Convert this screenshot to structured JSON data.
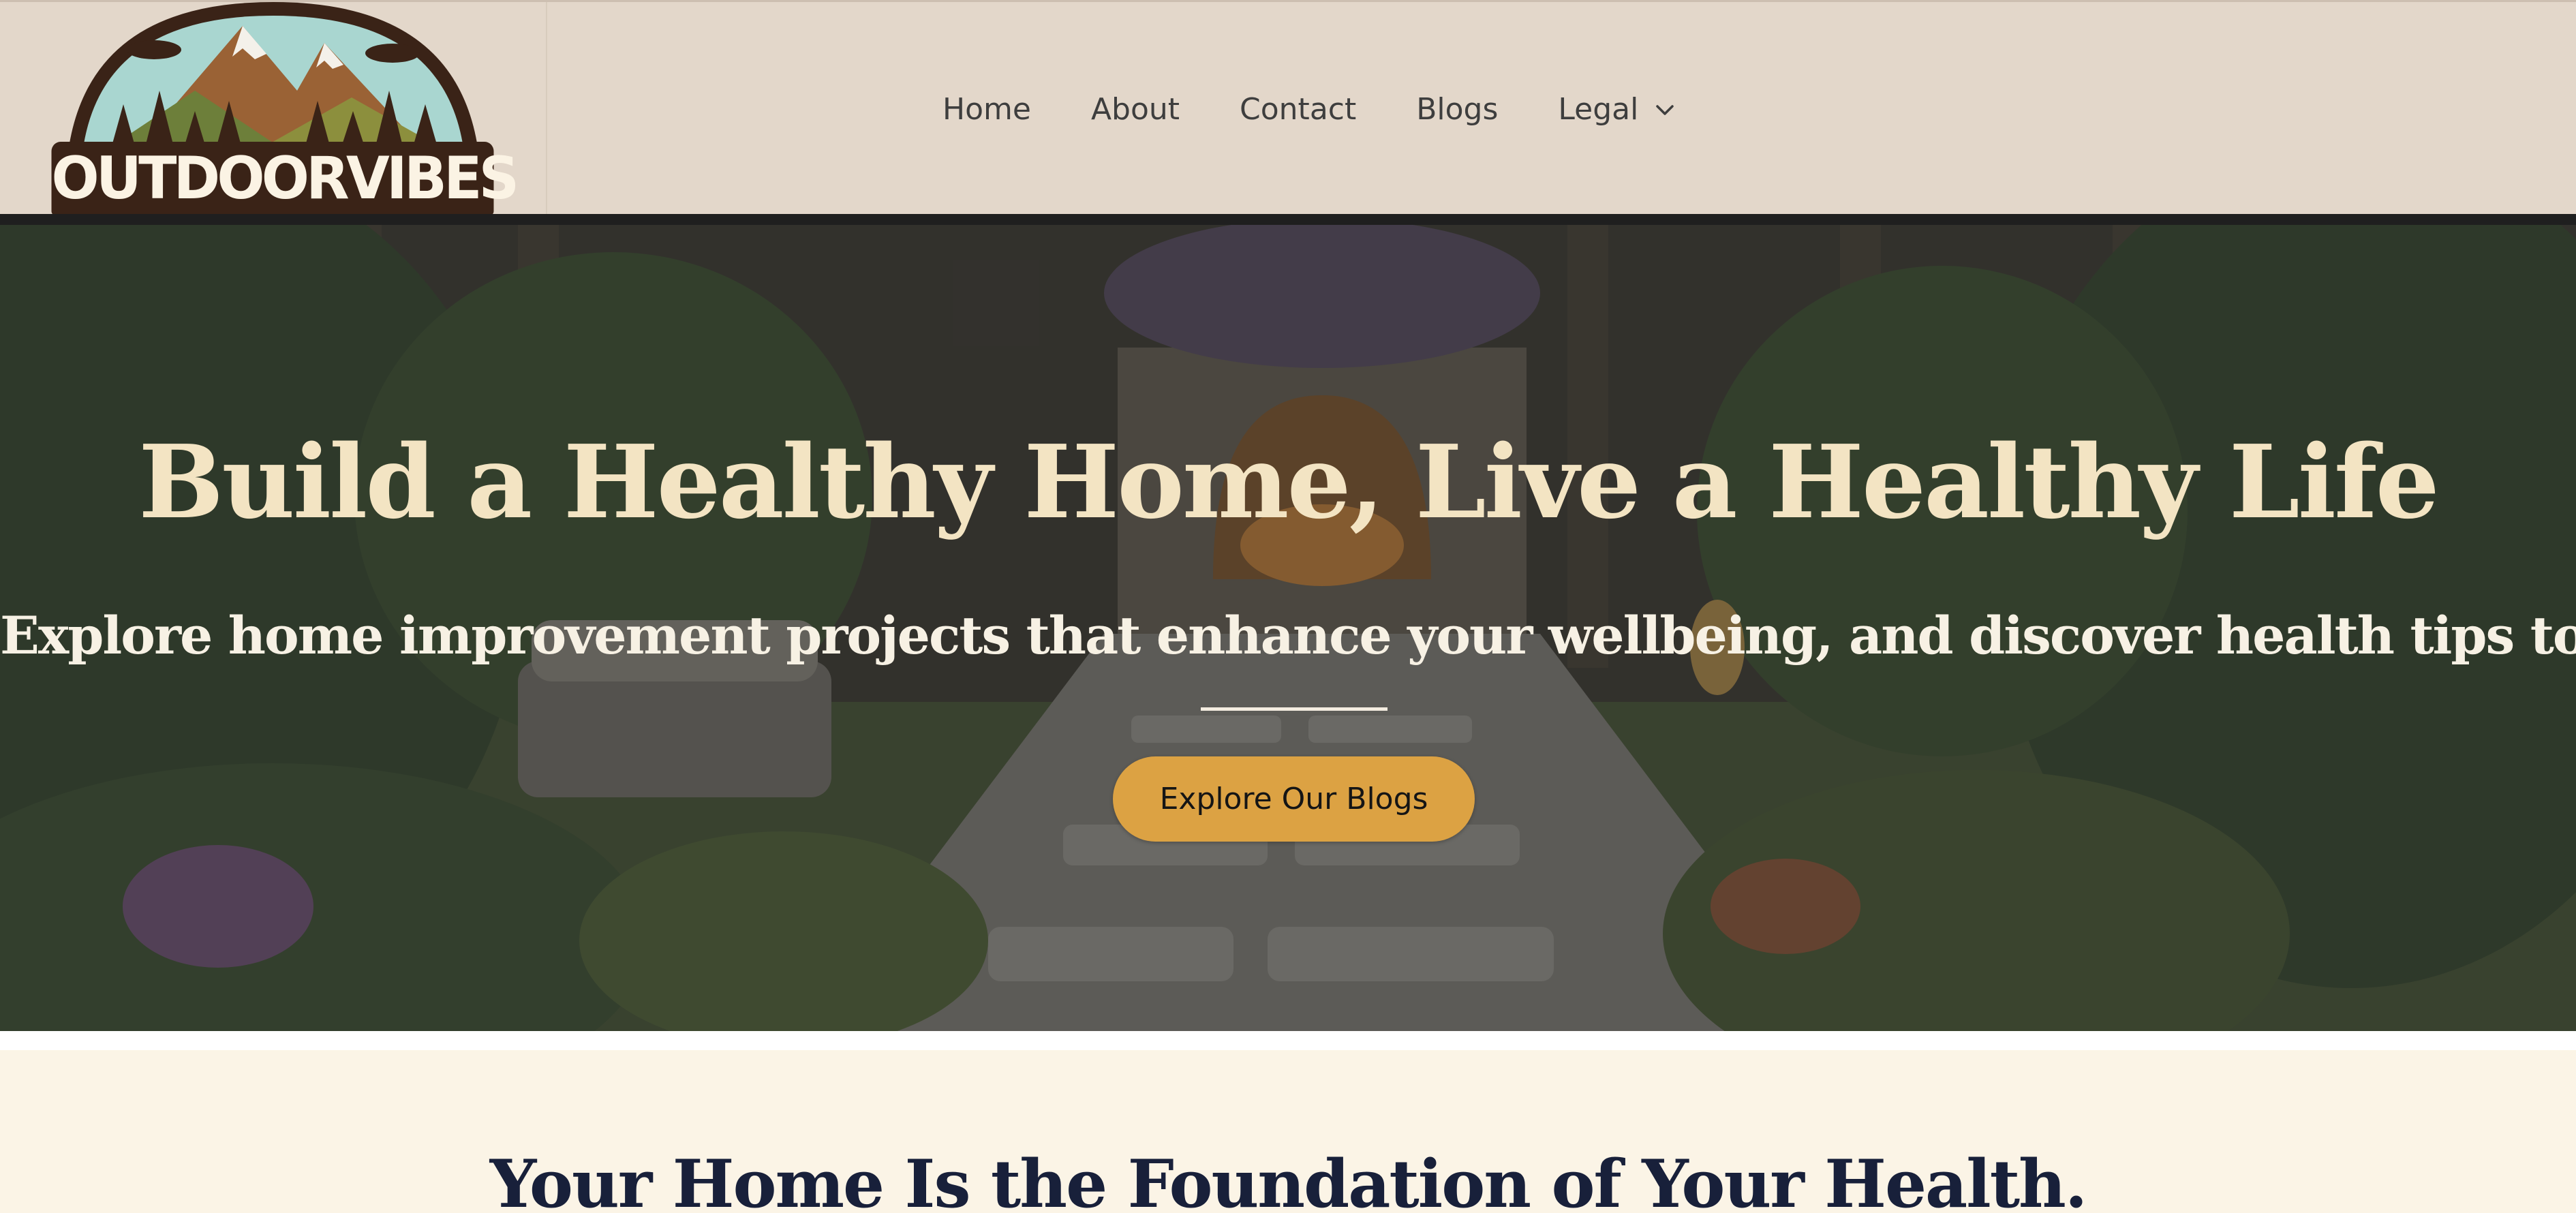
{
  "header": {
    "logo_text": "OUTDOORVIBES HUB",
    "nav": [
      {
        "label": "Home"
      },
      {
        "label": "About"
      },
      {
        "label": "Contact"
      },
      {
        "label": "Blogs"
      },
      {
        "label": "Legal",
        "icon": "chevron-down-icon"
      }
    ]
  },
  "hero": {
    "title": "Build a Healthy Home, Live a Healthy Life",
    "subtitle": "Explore home improvement projects that enhance your wellbeing, and discover health tips to thrive.",
    "cta_label": "Explore Our Blogs"
  },
  "section": {
    "title": "Your Home Is the Foundation of Your Health."
  },
  "colors": {
    "header_bg": "#e3d7ca",
    "accent_button": "#dca243",
    "hero_title": "#f3e4c3",
    "section_bg": "#fbf4e6",
    "section_title": "#18203a"
  }
}
